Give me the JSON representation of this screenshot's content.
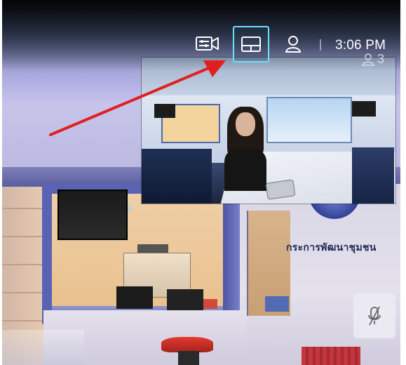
{
  "status_bar": {
    "time": "3:06 PM",
    "participant_count": "3",
    "participant_icon": "person-icon"
  },
  "controls": {
    "camera_control_icon": "camera-settings-icon",
    "layout_icon": "layout-icon",
    "layout_selected": true,
    "contacts_icon": "contacts-icon",
    "mute_icon": "microphone-muted-icon"
  },
  "main_view": {
    "room_sign": "กระการพัฒนาชุมชน"
  },
  "annotation": {
    "arrow_color": "#e02020"
  },
  "colors": {
    "accent": "#6ee0ff",
    "text": "#ffffff"
  }
}
